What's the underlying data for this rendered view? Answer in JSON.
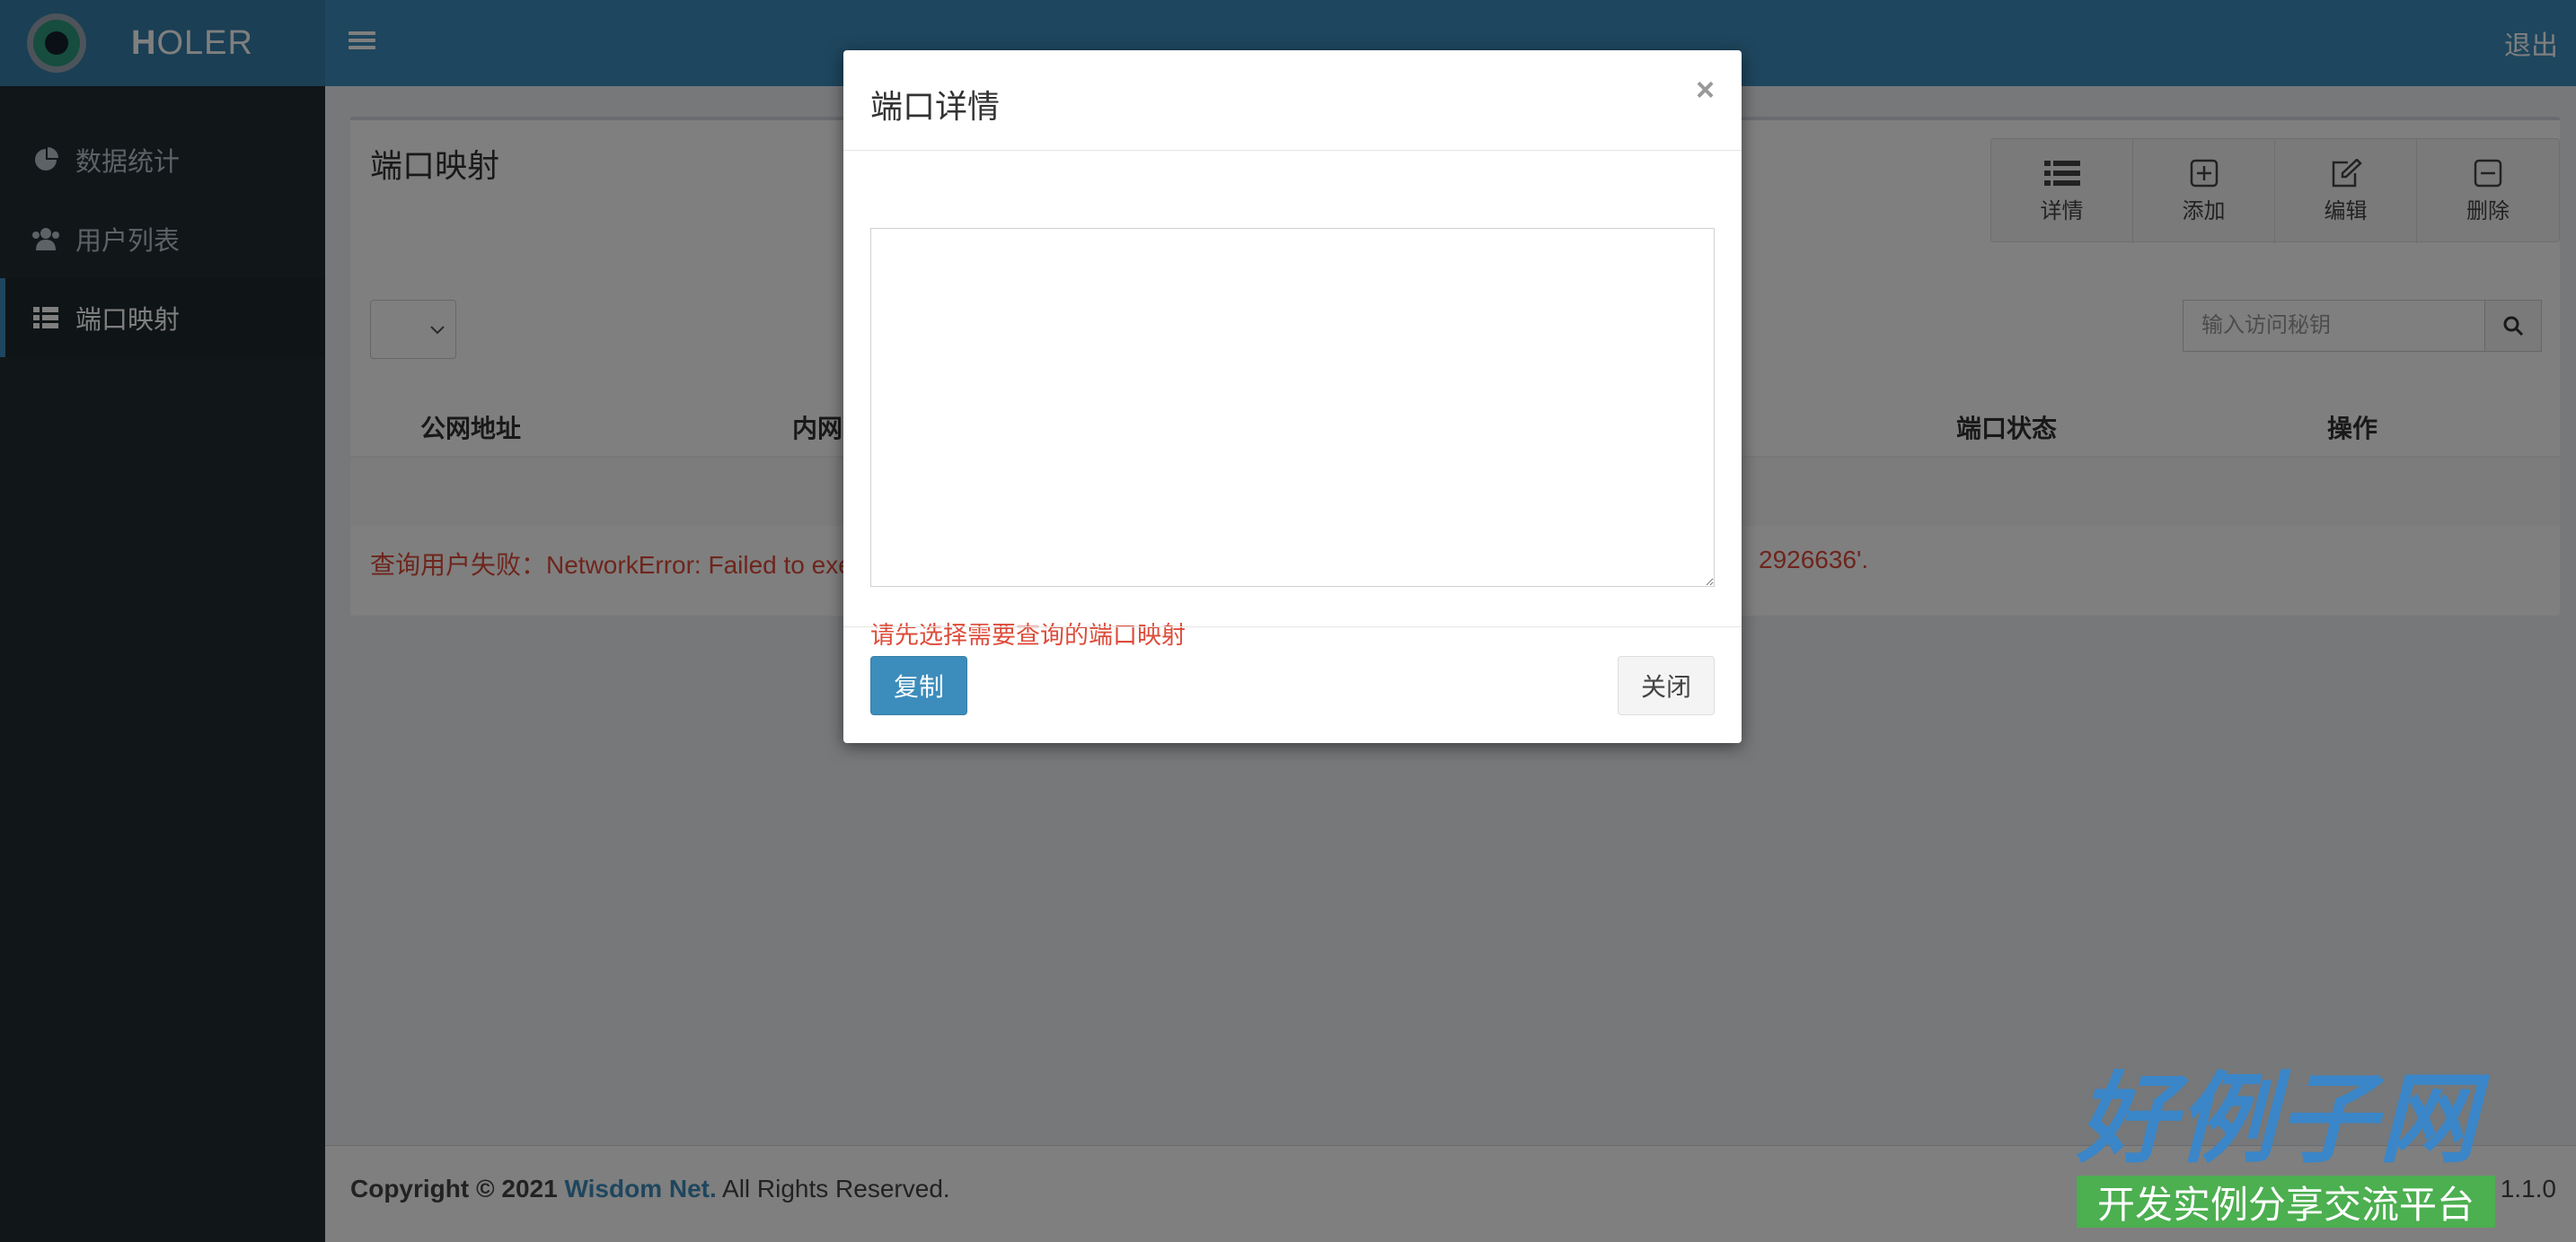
{
  "header": {
    "brand_initial": "H",
    "brand_rest": "OLER",
    "logout": "退出"
  },
  "sidebar": {
    "items": [
      {
        "label": "数据统计",
        "icon": "pie-chart-icon"
      },
      {
        "label": "用户列表",
        "icon": "users-icon"
      },
      {
        "label": "端口映射",
        "icon": "grid-icon",
        "active": true
      }
    ]
  },
  "main": {
    "page_title": "端口映射",
    "toolbar": {
      "details": "详情",
      "add": "添加",
      "edit": "编辑",
      "delete": "删除"
    },
    "search": {
      "placeholder": "输入访问秘钥"
    },
    "table": {
      "columns": [
        "公网地址",
        "内网",
        "端口状态",
        "操作"
      ]
    },
    "error_text": "查询用户失败：NetworkError: Failed to exe",
    "error_tail": "2926636'."
  },
  "modal": {
    "title": "端口详情",
    "close_symbol": "×",
    "textarea_value": "",
    "message": "请先选择需要查询的端口映射",
    "copy_button": "复制",
    "close_button": "关闭"
  },
  "footer": {
    "copyright_prefix": "Copyright © 2021",
    "company": "Wisdom Net.",
    "rights": "All Rights Reserved.",
    "version": "1.1.0"
  },
  "watermark": {
    "title": "好例子网",
    "subtitle": "开发实例分享交流平台"
  },
  "colors": {
    "header": "#3c8dbc",
    "sidebar": "#222d32",
    "error": "#dd4b39",
    "primary": "#3c8dbc"
  }
}
